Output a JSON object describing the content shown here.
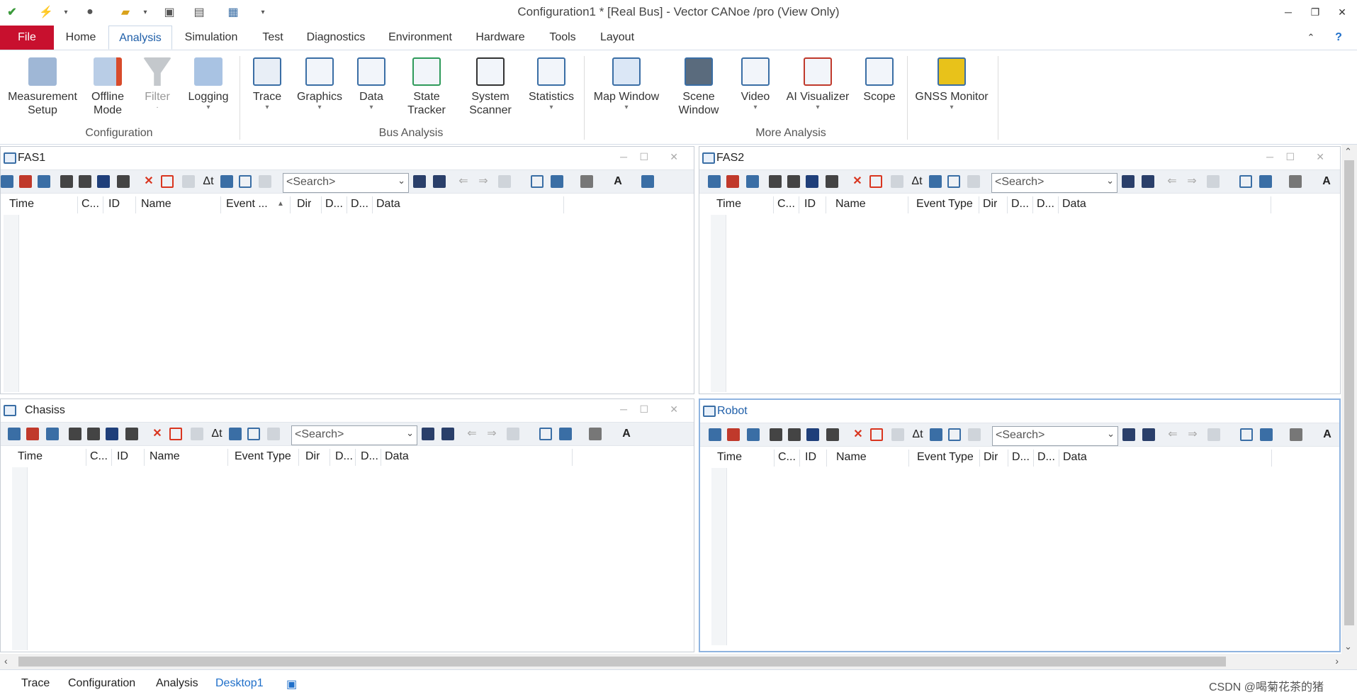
{
  "window": {
    "title": "Configuration1 * [Real Bus] - Vector CANoe /pro (View Only)"
  },
  "ribbon_tabs": [
    "File",
    "Home",
    "Analysis",
    "Simulation",
    "Test",
    "Diagnostics",
    "Environment",
    "Hardware",
    "Tools",
    "Layout"
  ],
  "active_tab": "Analysis",
  "ribbon": {
    "configuration": {
      "label": "Configuration",
      "buttons": [
        {
          "l1": "Measurement",
          "l2": "Setup"
        },
        {
          "l1": "Offline",
          "l2": "Mode"
        },
        {
          "l1": "Filter",
          "l2": ""
        },
        {
          "l1": "Logging",
          "l2": ""
        }
      ]
    },
    "bus_analysis": {
      "label": "Bus Analysis",
      "buttons": [
        {
          "l1": "Trace",
          "l2": ""
        },
        {
          "l1": "Graphics",
          "l2": ""
        },
        {
          "l1": "Data",
          "l2": ""
        },
        {
          "l1": "State",
          "l2": "Tracker"
        },
        {
          "l1": "System",
          "l2": "Scanner"
        },
        {
          "l1": "Statistics",
          "l2": ""
        }
      ]
    },
    "more_analysis": {
      "label": "More Analysis",
      "buttons": [
        {
          "l1": "Map Window",
          "l2": ""
        },
        {
          "l1": "Scene",
          "l2": "Window"
        },
        {
          "l1": "Video",
          "l2": ""
        },
        {
          "l1": "AI Visualizer",
          "l2": ""
        },
        {
          "l1": "Scope",
          "l2": ""
        },
        {
          "l1": "GNSS Monitor",
          "l2": ""
        }
      ]
    }
  },
  "panels": [
    {
      "title": "FAS1",
      "search_placeholder": "<Search>",
      "columns": [
        "Time",
        "C...",
        "ID",
        "Name",
        "Event ...",
        "Dir",
        "D...",
        "D...",
        "Data"
      ]
    },
    {
      "title": "FAS2",
      "search_placeholder": "<Search>",
      "columns": [
        "Time",
        "C...",
        "ID",
        "Name",
        "Event Type",
        "Dir",
        "D...",
        "D...",
        "Data"
      ]
    },
    {
      "title": "Chasiss",
      "search_placeholder": "<Search>",
      "columns": [
        "Time",
        "C...",
        "ID",
        "Name",
        "Event Type",
        "Dir",
        "D...",
        "D...",
        "Data"
      ]
    },
    {
      "title": "Robot",
      "search_placeholder": "<Search>",
      "columns": [
        "Time",
        "C...",
        "ID",
        "Name",
        "Event Type",
        "Dir",
        "D...",
        "D...",
        "Data"
      ]
    }
  ],
  "desktop_tabs": [
    "Trace",
    "Configuration",
    "Analysis",
    "Desktop1"
  ],
  "watermark": "CSDN @喝菊花茶的猪"
}
